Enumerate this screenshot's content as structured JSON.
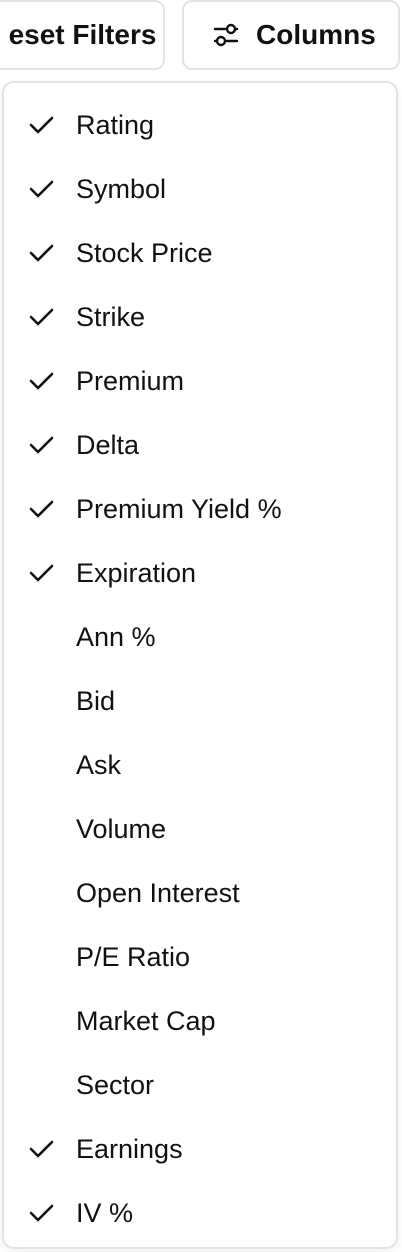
{
  "toolbar": {
    "reset_label": "eset Filters",
    "columns_label": "Columns",
    "columns_icon": "sliders-icon"
  },
  "menu": {
    "items": [
      {
        "label": "Rating",
        "checked": true
      },
      {
        "label": "Symbol",
        "checked": true
      },
      {
        "label": "Stock Price",
        "checked": true
      },
      {
        "label": "Strike",
        "checked": true
      },
      {
        "label": "Premium",
        "checked": true
      },
      {
        "label": "Delta",
        "checked": true
      },
      {
        "label": "Premium Yield %",
        "checked": true
      },
      {
        "label": "Expiration",
        "checked": true
      },
      {
        "label": "Ann %",
        "checked": false
      },
      {
        "label": "Bid",
        "checked": false
      },
      {
        "label": "Ask",
        "checked": false
      },
      {
        "label": "Volume",
        "checked": false
      },
      {
        "label": "Open Interest",
        "checked": false
      },
      {
        "label": "P/E Ratio",
        "checked": false
      },
      {
        "label": "Market Cap",
        "checked": false
      },
      {
        "label": "Sector",
        "checked": false
      },
      {
        "label": "Earnings",
        "checked": true
      },
      {
        "label": "IV %",
        "checked": true
      }
    ]
  }
}
